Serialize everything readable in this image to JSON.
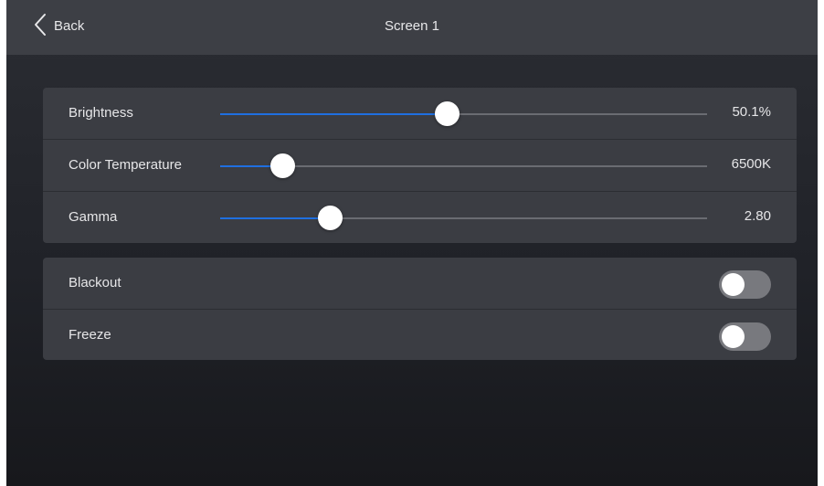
{
  "header": {
    "back_label": "Back",
    "title": "Screen 1"
  },
  "sliders": [
    {
      "label": "Brightness",
      "value_text": "50.1%",
      "position_fraction": 0.465
    },
    {
      "label": "Color Temperature",
      "value_text": "6500K",
      "position_fraction": 0.127
    },
    {
      "label": "Gamma",
      "value_text": "2.80",
      "position_fraction": 0.226
    }
  ],
  "toggles": [
    {
      "label": "Blackout",
      "on": false
    },
    {
      "label": "Freeze",
      "on": false
    }
  ],
  "colors": {
    "accent": "#1f6fe0",
    "panel": "#3b3d43",
    "topbar": "#3d3f45",
    "toggle_off": "#78797e"
  },
  "icons": {
    "back": "chevron-left-icon"
  }
}
